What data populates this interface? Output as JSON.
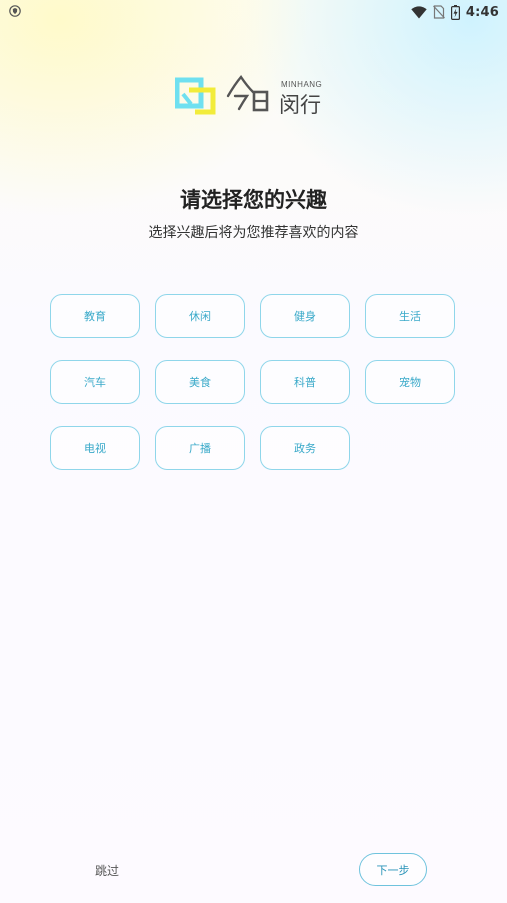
{
  "status_bar": {
    "time": "4:46"
  },
  "logo": {
    "en_text": "MINHANG",
    "cn_text": "闵行"
  },
  "header": {
    "title": "请选择您的兴趣",
    "subtitle": "选择兴趣后将为您推荐喜欢的内容"
  },
  "interests": [
    {
      "label": "教育"
    },
    {
      "label": "休闲"
    },
    {
      "label": "健身"
    },
    {
      "label": "生活"
    },
    {
      "label": "汽车"
    },
    {
      "label": "美食"
    },
    {
      "label": "科普"
    },
    {
      "label": "宠物"
    },
    {
      "label": "电视"
    },
    {
      "label": "广播"
    },
    {
      "label": "政务"
    }
  ],
  "actions": {
    "skip_label": "跳过",
    "next_label": "下一步"
  },
  "colors": {
    "accent": "#39a9c9",
    "chip_border": "#8fd6ea"
  }
}
